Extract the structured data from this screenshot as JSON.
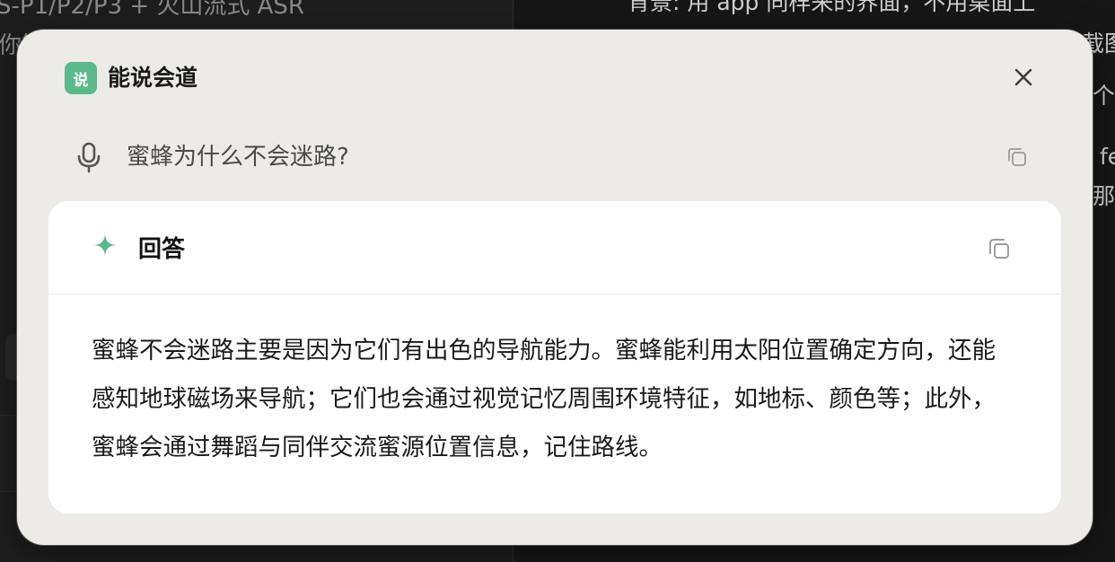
{
  "background": {
    "left_lines": [
      "S-P1/P2/P3 + 火山流式 ASR",
      "你管"
    ],
    "right_lines": [
      "背景: 用 app 同样来的界面，不用桌面上",
      "截图",
      "个",
      "fe",
      "那"
    ]
  },
  "dialog": {
    "app_badge": "说",
    "app_name": "能说会道",
    "query": "蜜蜂为什么不会迷路?",
    "answer_title": "回答",
    "answer_text": "蜜蜂不会迷路主要是因为它们有出色的导航能力。蜜蜂能利用太阳位置确定方向，还能感知地球磁场来导航；它们也会通过视觉记忆周围环境特征，如地标、颜色等；此外，蜜蜂会通过舞蹈与同伴交流蜜源位置信息，记住路线。"
  },
  "icons": {
    "app": "app-logo-icon",
    "close": "close-icon",
    "mic": "microphone-icon",
    "copy": "copy-icon",
    "sparkle": "sparkle-icon"
  },
  "colors": {
    "accent": "#5bb98b",
    "dialog_bg": "#ecebe8",
    "card_bg": "#ffffff",
    "text": "#1a1a1a"
  }
}
